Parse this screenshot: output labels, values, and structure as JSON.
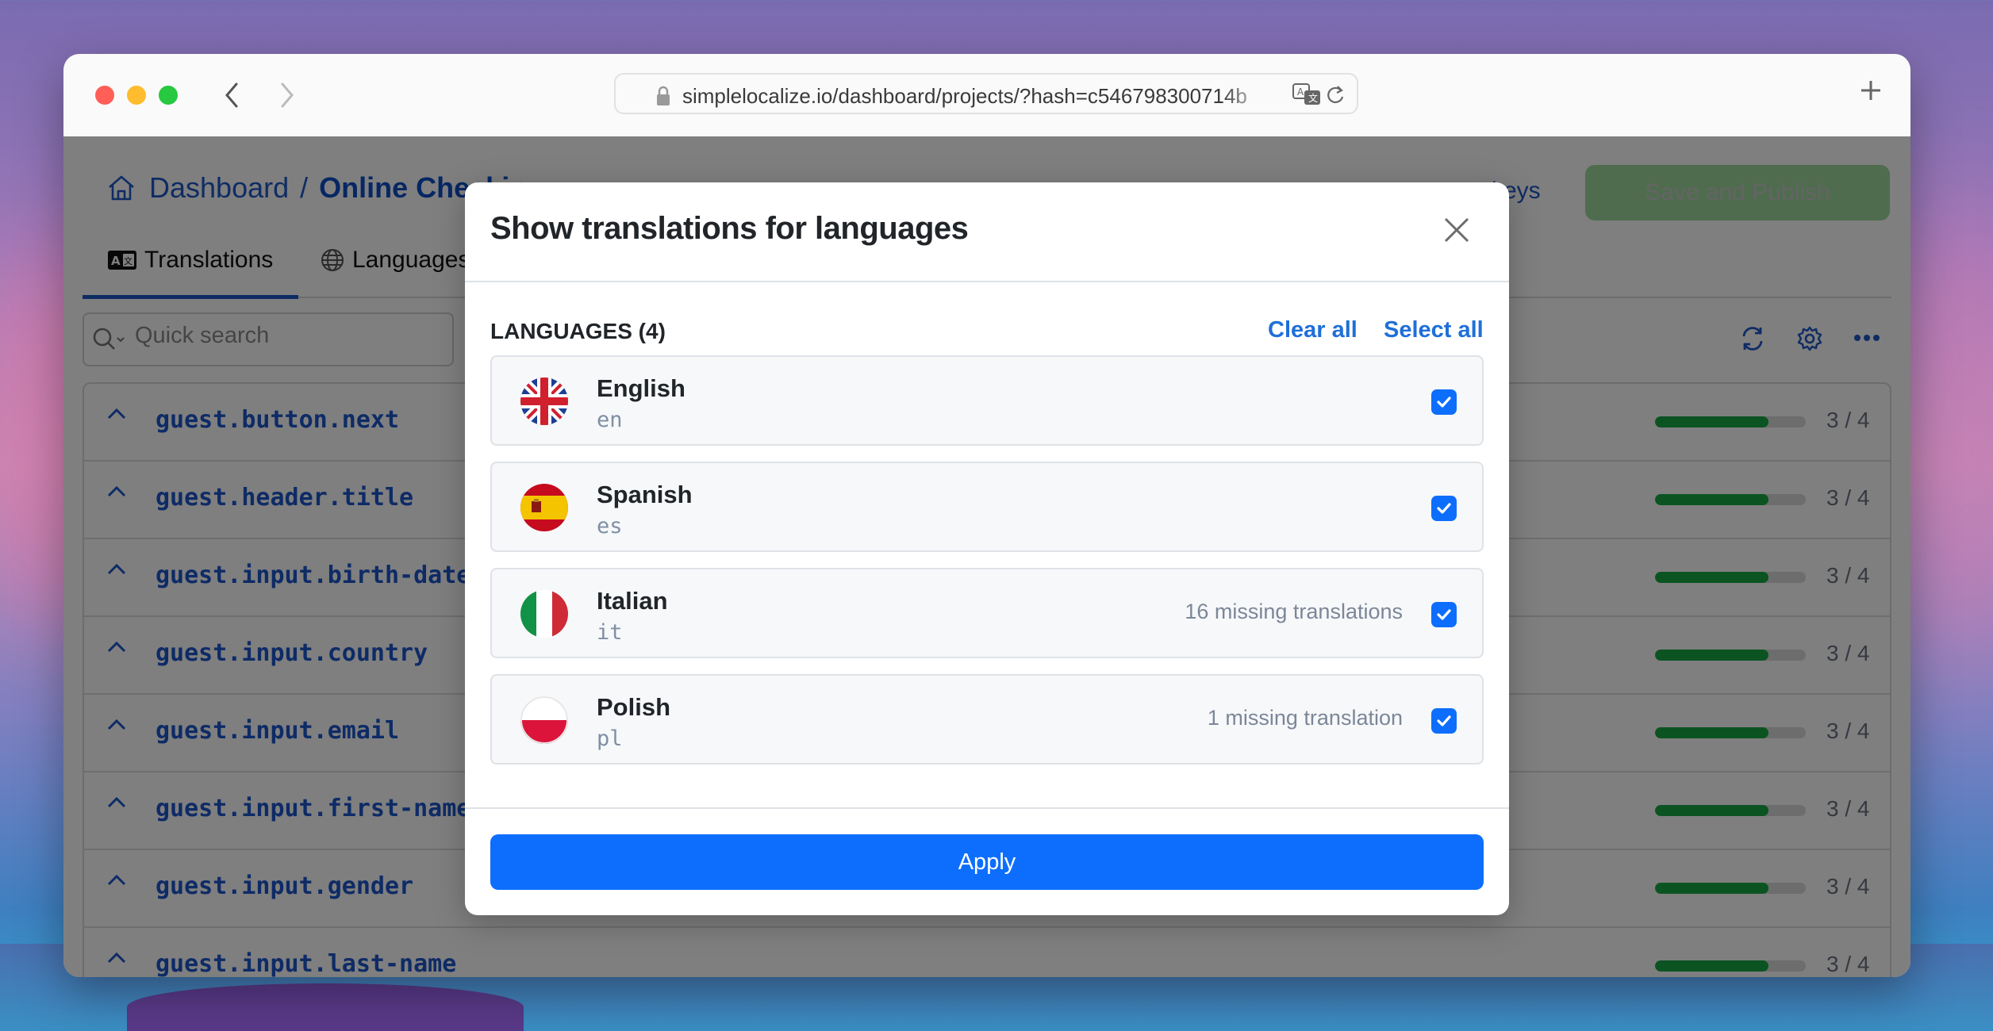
{
  "browser": {
    "url": "simplelocalize.io/dashboard/projects/?hash=c546798300714b",
    "back_label": "Back",
    "forward_label": "Forward",
    "new_tab_label": "New tab"
  },
  "header": {
    "breadcrumb_root": "Dashboard",
    "breadcrumb_separator": "/",
    "breadcrumb_current": "Online Checkin",
    "keys_link": "keys",
    "save_publish_label": "Save and Publish"
  },
  "tabs": [
    {
      "label": "Translations",
      "icon": "translate-icon",
      "active": true
    },
    {
      "label": "Languages",
      "icon": "globe-icon",
      "active": false
    }
  ],
  "search": {
    "placeholder": "Quick search",
    "value": ""
  },
  "keys": [
    {
      "name": "guest.button.next",
      "done": 3,
      "total": 4,
      "label": "3 / 4"
    },
    {
      "name": "guest.header.title",
      "done": 3,
      "total": 4,
      "label": "3 / 4"
    },
    {
      "name": "guest.input.birth-date",
      "done": 3,
      "total": 4,
      "label": "3 / 4"
    },
    {
      "name": "guest.input.country",
      "done": 3,
      "total": 4,
      "label": "3 / 4"
    },
    {
      "name": "guest.input.email",
      "done": 3,
      "total": 4,
      "label": "3 / 4"
    },
    {
      "name": "guest.input.first-name",
      "done": 3,
      "total": 4,
      "label": "3 / 4"
    },
    {
      "name": "guest.input.gender",
      "done": 3,
      "total": 4,
      "label": "3 / 4"
    },
    {
      "name": "guest.input.last-name",
      "done": 3,
      "total": 4,
      "label": "3 / 4"
    }
  ],
  "modal": {
    "title": "Show translations for languages",
    "section_label": "LANGUAGES (4)",
    "clear_all": "Clear all",
    "select_all": "Select all",
    "apply_label": "Apply",
    "languages": [
      {
        "name": "English",
        "code": "en",
        "missing": "",
        "checked": true,
        "flag": "uk-flag-icon"
      },
      {
        "name": "Spanish",
        "code": "es",
        "missing": "",
        "checked": true,
        "flag": "spain-flag-icon"
      },
      {
        "name": "Italian",
        "code": "it",
        "missing": "16 missing translations",
        "checked": true,
        "flag": "italy-flag-icon"
      },
      {
        "name": "Polish",
        "code": "pl",
        "missing": "1 missing translation",
        "checked": true,
        "flag": "poland-flag-icon"
      }
    ]
  },
  "colors": {
    "accent": "#0d6efd",
    "link": "#1f6fd8",
    "progress": "#17a844",
    "save_button": "#9fd89f"
  }
}
